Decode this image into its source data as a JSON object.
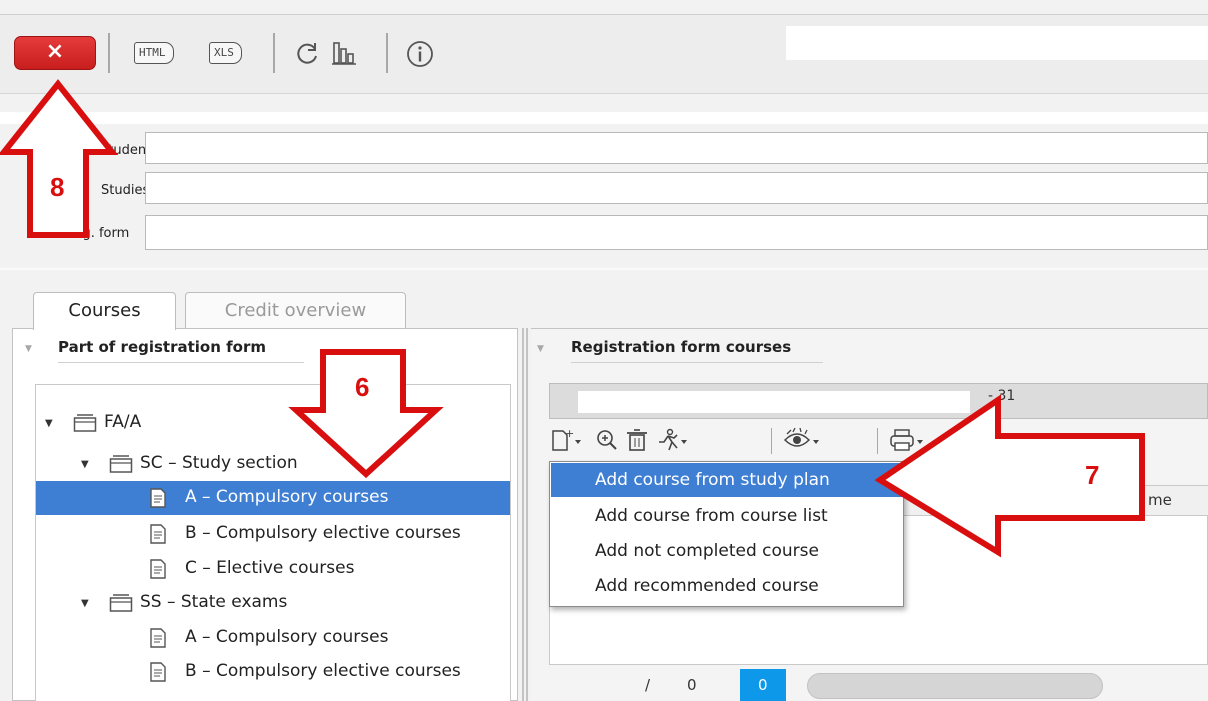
{
  "toolbar": {
    "close_label": "×",
    "html_label": "HTML",
    "xls_label": "XLS"
  },
  "header": {
    "student_label": "Student",
    "studies_label": "Studies",
    "reg_form_label": "Reg. form"
  },
  "tabs": [
    {
      "label": "Courses",
      "active": true
    },
    {
      "label": "Credit overview",
      "active": false
    }
  ],
  "left_panel": {
    "title": "Part of registration form",
    "tree": [
      {
        "label": "FA/A",
        "level": 0,
        "type": "folder",
        "expanded": true
      },
      {
        "label": "SC – Study section",
        "level": 1,
        "type": "folder",
        "expanded": true
      },
      {
        "label": "A – Compulsory courses",
        "level": 2,
        "type": "doc",
        "selected": true
      },
      {
        "label": "B – Compulsory elective courses",
        "level": 2,
        "type": "doc"
      },
      {
        "label": "C – Elective courses",
        "level": 2,
        "type": "doc"
      },
      {
        "label": "SS – State exams",
        "level": 1,
        "type": "folder",
        "expanded": true
      },
      {
        "label": "A – Compulsory courses",
        "level": 2,
        "type": "doc"
      },
      {
        "label": "B – Compulsory elective courses",
        "level": 2,
        "type": "doc"
      }
    ]
  },
  "right_panel": {
    "title": "Registration form courses",
    "info_fragment": "- 31",
    "column_header_fragment": "me",
    "pager": {
      "slash": "/",
      "left_value": "0",
      "active_value": "0"
    }
  },
  "dropdown": {
    "items": [
      {
        "label": "Add course from study plan",
        "highlighted": true
      },
      {
        "label": "Add course from course list",
        "highlighted": false
      },
      {
        "label": "Add not completed course",
        "highlighted": false
      },
      {
        "label": "Add recommended course",
        "highlighted": false
      }
    ]
  },
  "annotations": [
    {
      "label": "8"
    },
    {
      "label": "6"
    },
    {
      "label": "7"
    }
  ],
  "colors": {
    "selection": "#3f7fd3",
    "close_button": "#d42a2a",
    "annotation": "#d90f0f",
    "pager_active": "#0d98ea"
  }
}
